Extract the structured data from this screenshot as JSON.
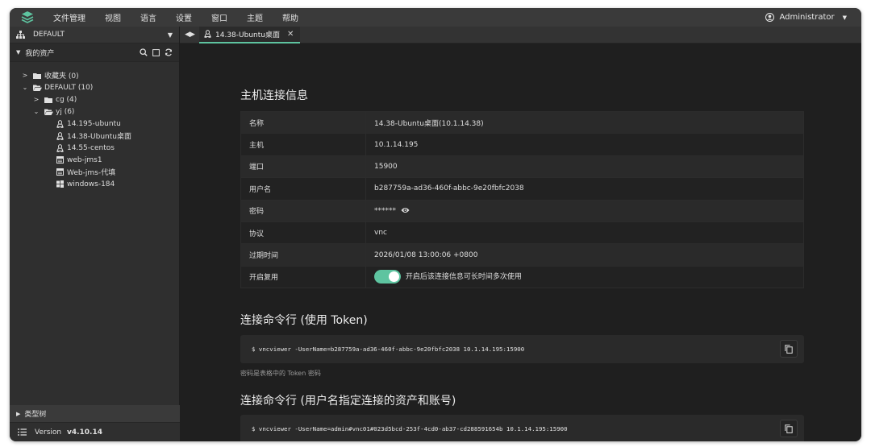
{
  "menubar": {
    "items": [
      "文件管理",
      "视图",
      "语言",
      "设置",
      "窗口",
      "主题",
      "帮助"
    ],
    "user": "Administrator"
  },
  "sidebar": {
    "org": "DEFAULT",
    "assets_title": "我的资产",
    "tree": [
      {
        "label": "收藏夹 (0)",
        "level": 0,
        "arrow": "right",
        "icon": "folder-icon"
      },
      {
        "label": "DEFAULT (10)",
        "level": 0,
        "arrow": "down",
        "icon": "folder-open-icon"
      },
      {
        "label": "cg (4)",
        "level": 1,
        "arrow": "right",
        "icon": "folder-icon"
      },
      {
        "label": "yj (6)",
        "level": 1,
        "arrow": "down",
        "icon": "folder-open-icon"
      },
      {
        "label": "14.195-ubuntu",
        "level": 2,
        "arrow": "",
        "icon": "linux-icon"
      },
      {
        "label": "14.38-Ubuntu桌面",
        "level": 2,
        "arrow": "",
        "icon": "linux-icon"
      },
      {
        "label": "14.55-centos",
        "level": 2,
        "arrow": "",
        "icon": "linux-icon"
      },
      {
        "label": "web-jms1",
        "level": 2,
        "arrow": "",
        "icon": "web-icon"
      },
      {
        "label": "Web-jms-代填",
        "level": 2,
        "arrow": "",
        "icon": "web-icon"
      },
      {
        "label": "windows-184",
        "level": 2,
        "arrow": "",
        "icon": "windows-icon"
      }
    ],
    "type_tree": "类型树",
    "version_label": "Version",
    "version": "v4.10.14"
  },
  "tab": {
    "label": "14.38-Ubuntu桌面"
  },
  "main": {
    "info_title": "主机连接信息",
    "rows": [
      {
        "key": "名称",
        "value": "14.38-Ubuntu桌面(10.1.14.38)"
      },
      {
        "key": "主机",
        "value": "10.1.14.195"
      },
      {
        "key": "端口",
        "value": "15900"
      },
      {
        "key": "用户名",
        "value": "b287759a-ad36-460f-abbc-9e20fbfc2038"
      },
      {
        "key": "密码",
        "value": "******"
      },
      {
        "key": "协议",
        "value": "vnc"
      },
      {
        "key": "过期时间",
        "value": "2026/01/08 13:00:06 +0800"
      },
      {
        "key": "开启复用",
        "value": "开启后该连接信息可长时间多次使用"
      }
    ],
    "cmd_token_title": "连接命令行 (使用 Token)",
    "cmd_token": "$ vncviewer -UserName=b287759a-ad36-460f-abbc-9e20fbfc2038 10.1.14.195:15900",
    "token_hint": "密码是表格中的 Token 密码",
    "cmd_user_title": "连接命令行 (用户名指定连接的资产和账号)",
    "cmd_user": "$ vncviewer -UserName=admin#vnc01#023d5bcd-253f-4cd0-ab37-cd288591654b 10.1.14.195:15900"
  },
  "colors": {
    "accent": "#5ec4a0",
    "background": "#1f1f1f",
    "sidebar": "#2f2f2f"
  }
}
